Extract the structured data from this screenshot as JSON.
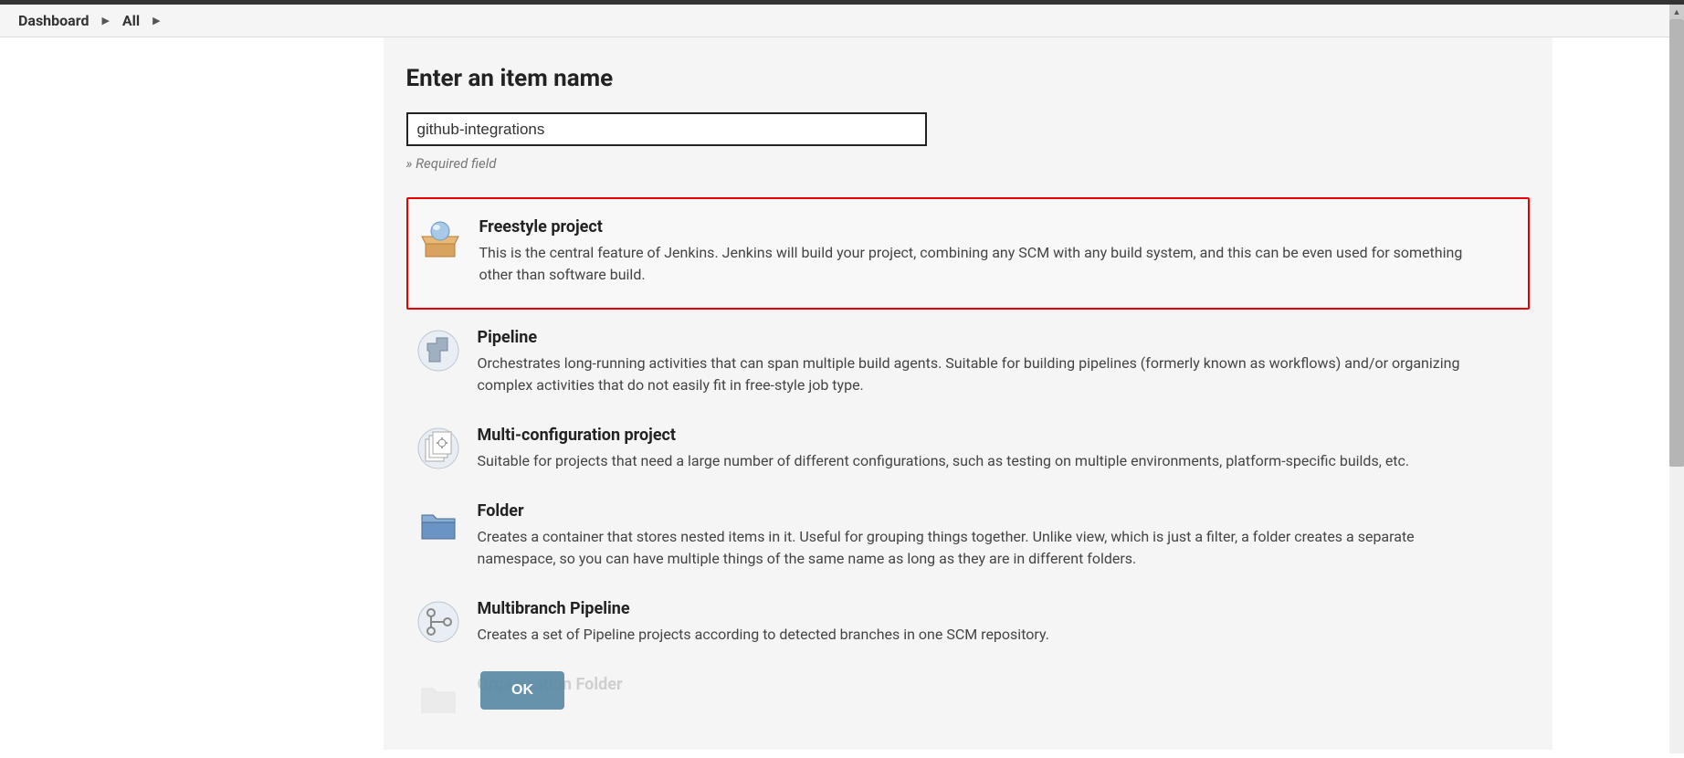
{
  "breadcrumb": {
    "items": [
      "Dashboard",
      "All"
    ]
  },
  "page": {
    "title": "Enter an item name",
    "input_value": "github-integrations",
    "input_prefix": "github",
    "input_suffix": "-integrations",
    "required_note": "» Required field"
  },
  "items": [
    {
      "title": "Freestyle project",
      "desc": "This is the central feature of Jenkins. Jenkins will build your project, combining any SCM with any build system, and this can be even used for something other than software build.",
      "icon": "freestyle-icon",
      "selected": true
    },
    {
      "title": "Pipeline",
      "desc": "Orchestrates long-running activities that can span multiple build agents. Suitable for building pipelines (formerly known as workflows) and/or organizing complex activities that do not easily fit in free-style job type.",
      "icon": "pipeline-icon",
      "selected": false
    },
    {
      "title": "Multi-configuration project",
      "desc": "Suitable for projects that need a large number of different configurations, such as testing on multiple environments, platform-specific builds, etc.",
      "icon": "multiconfig-icon",
      "selected": false
    },
    {
      "title": "Folder",
      "desc": "Creates a container that stores nested items in it. Useful for grouping things together. Unlike view, which is just a filter, a folder creates a separate namespace, so you can have multiple things of the same name as long as they are in different folders.",
      "icon": "folder-icon",
      "selected": false
    },
    {
      "title": "Multibranch Pipeline",
      "desc": "Creates a set of Pipeline projects according to detected branches in one SCM repository.",
      "icon": "multibranch-icon",
      "selected": false
    },
    {
      "title": "Organization Folder",
      "desc": "",
      "icon": "org-folder-icon",
      "selected": false
    }
  ],
  "ok_button": "OK"
}
